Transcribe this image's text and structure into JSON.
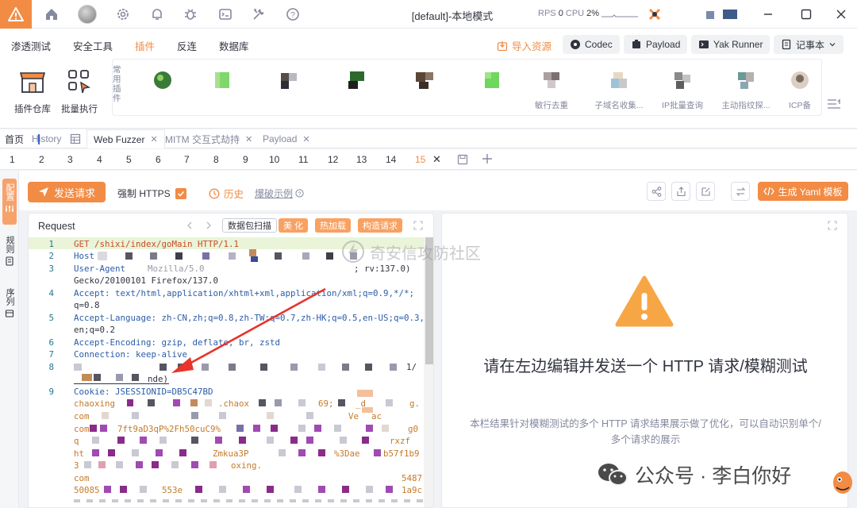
{
  "titlebar": {
    "title": "[default]-本地模式",
    "rps_label": "RPS",
    "rps_value": "0",
    "cpu_label": "CPU",
    "cpu_value": "2%"
  },
  "menu": {
    "items": [
      "渗透测试",
      "安全工具",
      "插件",
      "反连",
      "数据库"
    ],
    "active": "插件",
    "import_label": "导入资源",
    "codec_label": "Codec",
    "payload_label": "Payload",
    "yakrunner_label": "Yak Runner",
    "notebook_label": "记事本"
  },
  "ribbon": {
    "tools": [
      "插件仓库",
      "批量执行"
    ],
    "common_label": "常用插件",
    "plugins": [
      "",
      "",
      "",
      "",
      "",
      "",
      "敏行去重",
      "子域名收集...",
      "IP批量查询",
      "主动指纹探...",
      "ICP备"
    ]
  },
  "page_tabs": {
    "home": "首页",
    "history": "History",
    "items": [
      "Web Fuzzer",
      "MITM 交互式劫持",
      "Payload"
    ],
    "active": "Web Fuzzer"
  },
  "num_tabs": {
    "items": [
      "1",
      "2",
      "3",
      "4",
      "5",
      "6",
      "7",
      "8",
      "9",
      "10",
      "11",
      "12",
      "13",
      "14",
      "15"
    ],
    "active": "15"
  },
  "side_tabs": [
    "配置",
    "规则",
    "序列"
  ],
  "actions": {
    "send": "发送请求",
    "force_https": "强制 HTTPS",
    "history": "历史",
    "examples": "爆破示例",
    "yaml": "生成 Yaml 模板"
  },
  "request": {
    "title": "Request",
    "scan_btn": "数据包扫描",
    "beautify_btn": "美 化",
    "hotload_btn": "热加载",
    "construct_btn": "构造请求",
    "lines": [
      {
        "n": "1",
        "text": "GET /shixi/index/goMain HTTP/1.1"
      },
      {
        "n": "2",
        "text": "Host"
      },
      {
        "n": "3",
        "text": "User-Agent"
      },
      {
        "n": "",
        "text": "Gecko/20100101 Firefox/137.0"
      },
      {
        "n": "4",
        "text": "Accept: text/html,application/xhtml+xml,application/xml;q=0.9,*/*;"
      },
      {
        "n": "",
        "text": "q=0.8"
      },
      {
        "n": "5",
        "text": "Accept-Language: zh-CN,zh;q=0.8,zh-TW;q=0.7,zh-HK;q=0.5,en-US;q=0.3,"
      },
      {
        "n": "",
        "text": "en;q=0.2"
      },
      {
        "n": "6",
        "text": "Accept-Encoding: gzip, deflate, br, zstd"
      },
      {
        "n": "7",
        "text": "Connection: keep-alive"
      },
      {
        "n": "8",
        "text": ""
      },
      {
        "n": "",
        "text": "nde)"
      },
      {
        "n": "9",
        "text": "Cookie: JSESSIONID=DB5C47BD"
      },
      {
        "n": "",
        "text": "chaoxing"
      },
      {
        "n": "",
        "text": "com"
      },
      {
        "n": "",
        "text": "7ft9aD3qP%2Fh50cuC9%"
      },
      {
        "n": "",
        "text": "ht"
      },
      {
        "n": "",
        "text": "Zmkua3P"
      },
      {
        "n": "",
        "text": "com"
      },
      {
        "n": "",
        "text": "50085"
      }
    ],
    "fragments": {
      "ua_tail": "; rv:137.0)",
      "line8_tail": "1/",
      "cookie_chaox": ".chaox",
      "cookie_69": "69;",
      "cookie_d": "_d",
      "cookie_g": "g.",
      "cookie_ve": "Ve",
      "cookie_ac": "ac",
      "cookie_g0": "g0",
      "cookie_xf": "rxzf",
      "cookie_3dae": "%3Dae",
      "cookie_b57": "b57f1b9",
      "cookie_oxing": "oxing.",
      "cookie_5487": "5487",
      "cookie_553e": "553e",
      "cookie_1a9c": "1a9c"
    }
  },
  "response": {
    "title": "请在左边编辑并发送一个 HTTP 请求/模糊测试",
    "desc": "本栏结果针对模糊测试的多个 HTTP 请求结果展示做了优化，可以自动识别单个/多个请求的展示"
  },
  "watermarks": {
    "community": "奇安信攻防社区",
    "wechat": "公众号 · 李白你好"
  },
  "colors": {
    "accent": "#f28b44",
    "warning": "#f7a645"
  }
}
